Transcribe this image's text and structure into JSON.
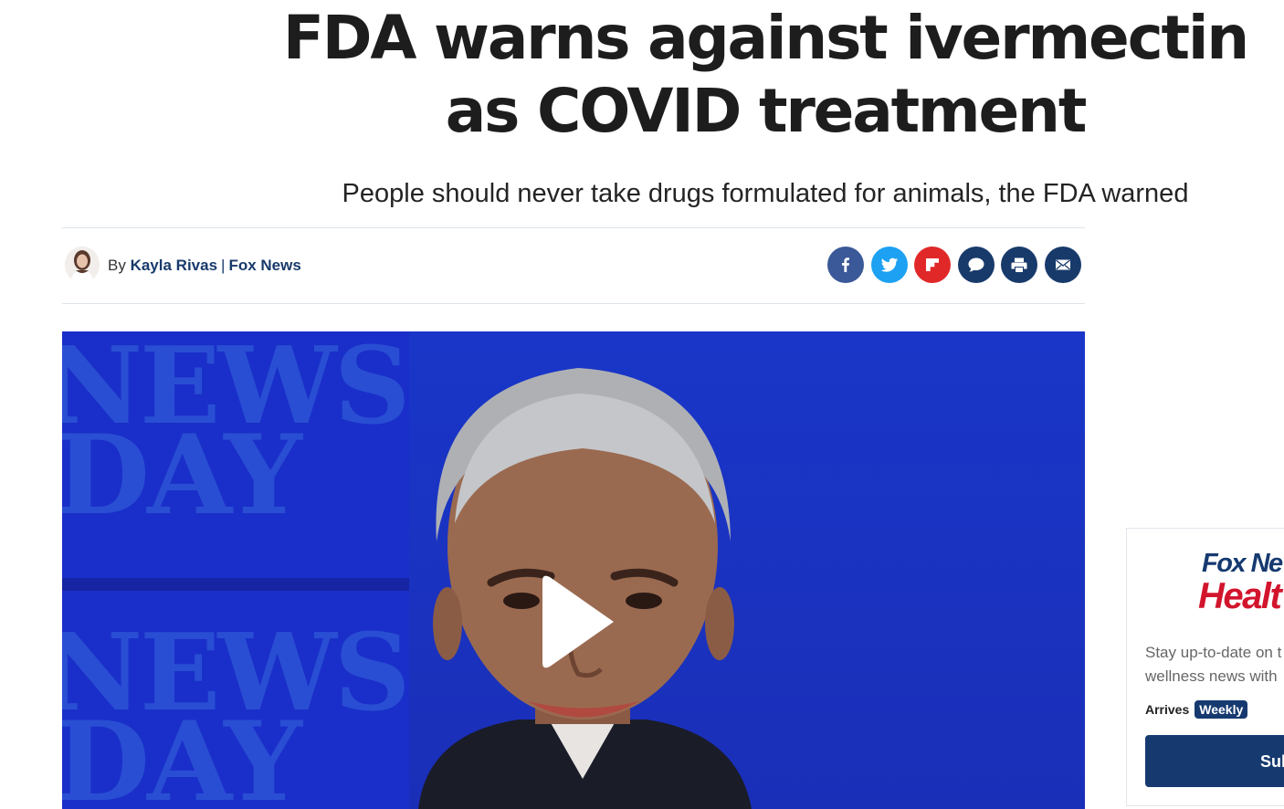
{
  "article": {
    "headline": "FDA warns against ivermectin as COVID treatment",
    "subheadline": "People should never take drugs formulated for animals, the FDA warned"
  },
  "byline": {
    "prefix": "By",
    "author": "Kayla Rivas",
    "separator": "|",
    "outlet": "Fox News"
  },
  "share_buttons": [
    {
      "icon": "facebook-icon",
      "color": "#3b5998"
    },
    {
      "icon": "twitter-icon",
      "color": "#1da1f2"
    },
    {
      "icon": "flipboard-icon",
      "color": "#e12828"
    },
    {
      "icon": "comment-icon",
      "color": "#183a6b"
    },
    {
      "icon": "print-icon",
      "color": "#183a6b"
    },
    {
      "icon": "email-icon",
      "color": "#183a6b"
    }
  ],
  "video": {
    "background_text": [
      "NEWS",
      "DAY",
      "NEWS",
      "DAY"
    ],
    "play_icon": "play-icon"
  },
  "newsletter_promo": {
    "brand_line1": "Fox Ne",
    "brand_line2": "Healt",
    "description_line1": "Stay up-to-date on t",
    "description_line2": "wellness news with",
    "frequency_label": "Arrives",
    "frequency_value": "Weekly",
    "subscribe_label": "Sub"
  }
}
